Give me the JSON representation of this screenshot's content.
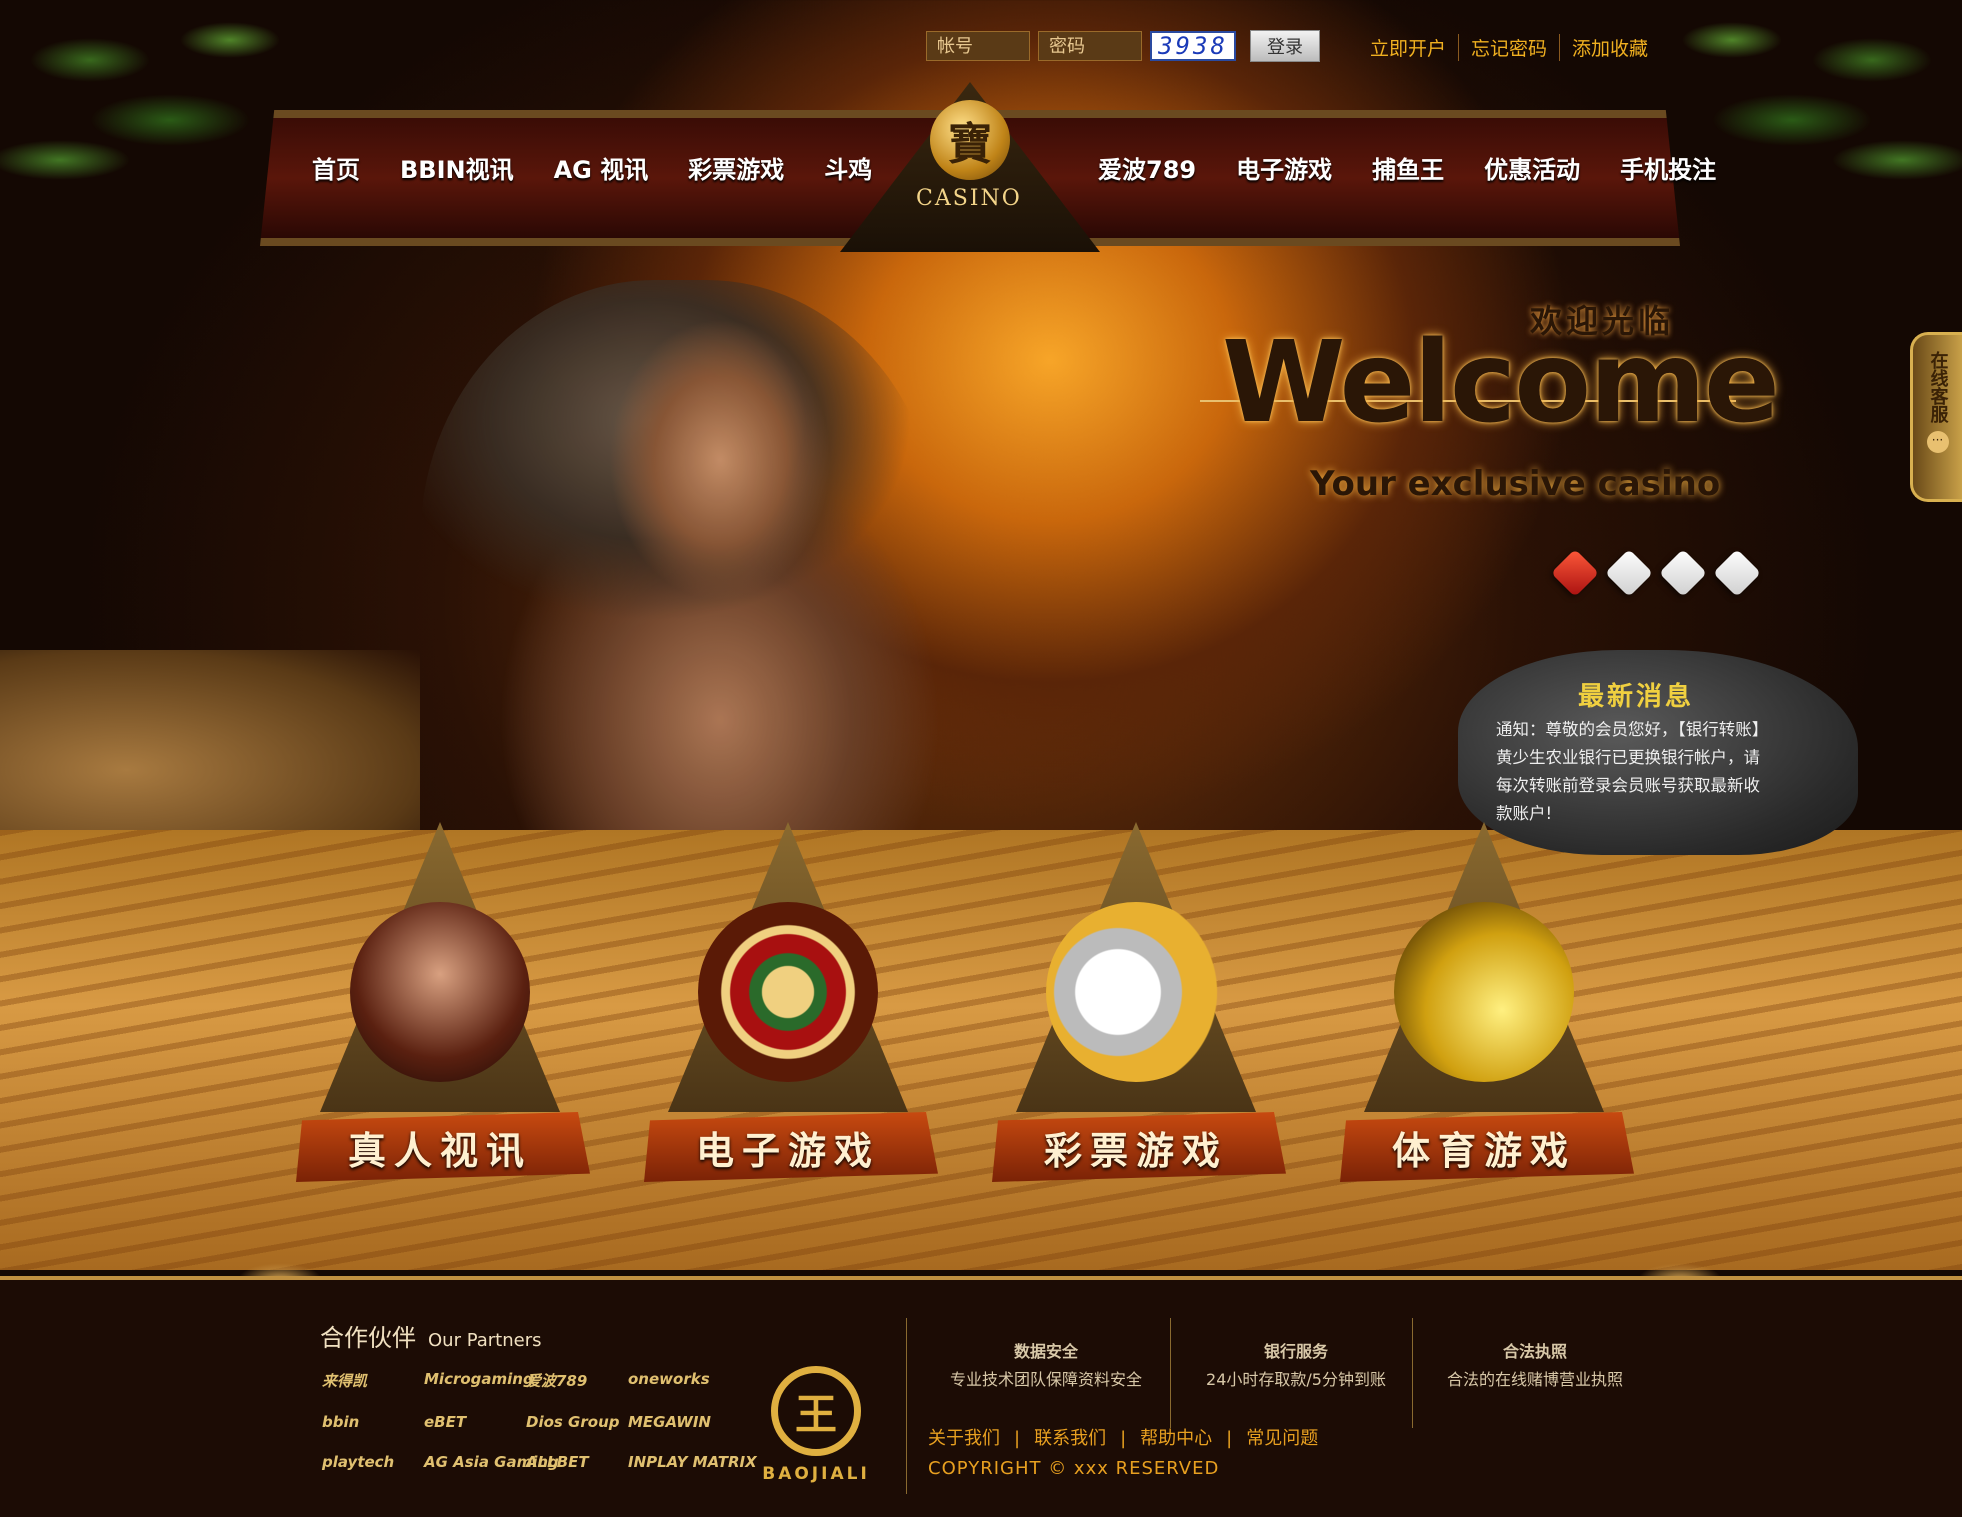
{
  "login": {
    "account_placeholder": "帐号",
    "password_placeholder": "密码",
    "captcha": "3938",
    "submit": "登录"
  },
  "toplinks": [
    "立即开户",
    "忘记密码",
    "添加收藏"
  ],
  "nav": {
    "left": [
      "首页",
      "BBIN视讯",
      "AG 视讯",
      "彩票游戏",
      "斗鸡"
    ],
    "right": [
      "爱波789",
      "电子游戏",
      "捕鱼王",
      "优惠活动",
      "手机投注"
    ]
  },
  "logo": {
    "glyph": "寶",
    "word": "CASINO"
  },
  "hero": {
    "welcome_cn": "欢迎光临",
    "welcome_en": "Welcome",
    "subtitle": "Your exclusive casino"
  },
  "chat_tab": "在线客服",
  "news": {
    "title": "最新消息",
    "body": "通知：尊敬的会员您好，【银行转账】黄少生农业银行已更换银行帐户，请每次转账前登录会员账号获取最新收款账户!"
  },
  "games": [
    "真人视讯",
    "电子游戏",
    "彩票游戏",
    "体育游戏"
  ],
  "footer": {
    "partners_title": "合作伙伴",
    "partners_subtitle": "Our Partners",
    "partners": [
      "来得凯",
      "Microgaming",
      "爱波789",
      "oneworks",
      "bbin",
      "eBET",
      "Dios Group",
      "MEGAWIN",
      "playtech",
      "AG Asia Gaming",
      "ALLBET",
      "INPLAY MATRIX"
    ],
    "brand_glyph": "王",
    "brand_word": "BAOJIALI",
    "features": [
      {
        "title": "数据安全",
        "text": "专业技术团队保障资料安全"
      },
      {
        "title": "银行服务",
        "text": "24小时存取款/5分钟到账"
      },
      {
        "title": "合法执照",
        "text": "合法的在线赌博营业执照"
      }
    ],
    "links": [
      "关于我们",
      "联系我们",
      "帮助中心",
      "常见问题"
    ],
    "copyright": "COPYRIGHT  © xxx RESERVED"
  }
}
